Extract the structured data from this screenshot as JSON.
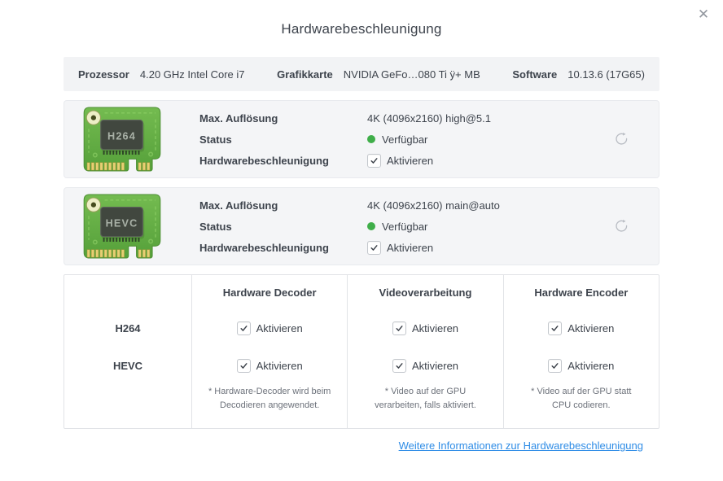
{
  "dialog": {
    "title": "Hardwarebeschleunigung",
    "close_glyph": "✕"
  },
  "system_info": [
    {
      "label": "Prozessor",
      "value": "4.20 GHz Intel Core i7"
    },
    {
      "label": "Grafikkarte",
      "value": "NVIDIA GeFo…080 Ti ÿ+ MB"
    },
    {
      "label": "Software",
      "value": "10.13.6 (17G65)"
    }
  ],
  "codec_cards": [
    {
      "codec": "H264",
      "rows": [
        {
          "label": "Max. Auflösung",
          "value": "4K (4096x2160) high@5.1",
          "type": "text"
        },
        {
          "label": "Status",
          "value": "Verfügbar",
          "type": "status",
          "status_color": "#3fae49"
        },
        {
          "label": "Hardwarebeschleunigung",
          "value": "Aktivieren",
          "type": "checkbox",
          "checked": true
        }
      ]
    },
    {
      "codec": "HEVC",
      "rows": [
        {
          "label": "Max. Auflösung",
          "value": "4K (4096x2160) main@auto",
          "type": "text"
        },
        {
          "label": "Status",
          "value": "Verfügbar",
          "type": "status",
          "status_color": "#3fae49"
        },
        {
          "label": "Hardwarebeschleunigung",
          "value": "Aktivieren",
          "type": "checkbox",
          "checked": true
        }
      ]
    }
  ],
  "table": {
    "headers": [
      "Hardware Decoder",
      "Videoverarbeitung",
      "Hardware Encoder"
    ],
    "rows": [
      {
        "codec": "H264",
        "cells": [
          {
            "label": "Aktivieren",
            "checked": true
          },
          {
            "label": "Aktivieren",
            "checked": true
          },
          {
            "label": "Aktivieren",
            "checked": true
          }
        ]
      },
      {
        "codec": "HEVC",
        "cells": [
          {
            "label": "Aktivieren",
            "checked": true
          },
          {
            "label": "Aktivieren",
            "checked": true
          },
          {
            "label": "Aktivieren",
            "checked": true
          }
        ]
      }
    ],
    "footnotes": [
      "* Hardware-Decoder wird beim Decodieren angewendet.",
      "* Video auf der GPU verarbeiten, falls aktiviert.",
      "* Video auf der GPU statt CPU codieren."
    ]
  },
  "footer": {
    "link": "Weitere Informationen zur Hardwarebeschleunigung"
  },
  "colors": {
    "status_green": "#3fae49",
    "link_blue": "#2e8ce6",
    "panel_bg": "#f2f3f5",
    "card_bg": "#f4f5f7"
  }
}
